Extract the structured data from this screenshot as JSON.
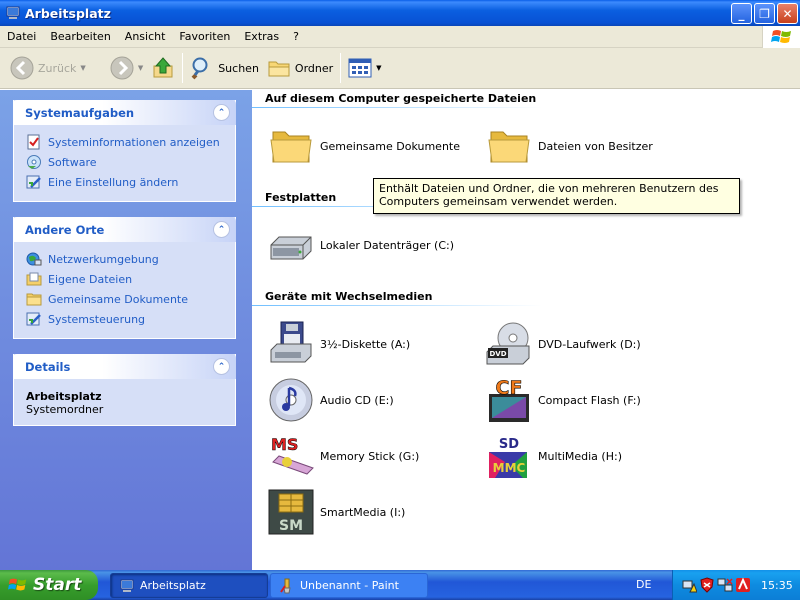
{
  "window": {
    "title": "Arbeitsplatz",
    "buttons": {
      "minimize": "_",
      "maximize": "❐",
      "close": "✕"
    }
  },
  "menu": {
    "items": [
      {
        "label": "Datei"
      },
      {
        "label": "Bearbeiten"
      },
      {
        "label": "Ansicht"
      },
      {
        "label": "Favoriten"
      },
      {
        "label": "Extras"
      },
      {
        "label": "?"
      }
    ]
  },
  "toolbar": {
    "back_label": "Zurück",
    "search_label": "Suchen",
    "folders_label": "Ordner"
  },
  "sidebar": {
    "system_tasks": {
      "title": "Systemaufgaben",
      "items": [
        {
          "label": "Systeminformationen anzeigen",
          "icon": "sysinfo-icon"
        },
        {
          "label": "Software",
          "icon": "software-icon"
        },
        {
          "label": "Eine Einstellung ändern",
          "icon": "settings-icon"
        }
      ]
    },
    "other_places": {
      "title": "Andere Orte",
      "items": [
        {
          "label": "Netzwerkumgebung",
          "icon": "network-icon"
        },
        {
          "label": "Eigene Dateien",
          "icon": "documents-icon"
        },
        {
          "label": "Gemeinsame Dokumente",
          "icon": "folder-icon"
        },
        {
          "label": "Systemsteuerung",
          "icon": "control-panel-icon"
        }
      ]
    },
    "details": {
      "title": "Details",
      "name": "Arbeitsplatz",
      "type": "Systemordner"
    }
  },
  "main": {
    "stored_files": {
      "title": "Auf diesem Computer gespeicherte Dateien",
      "items": [
        {
          "label": "Gemeinsame Dokumente",
          "icon": "folder-icon"
        },
        {
          "label": "Dateien von Besitzer",
          "icon": "folder-icon"
        }
      ]
    },
    "hard_disks": {
      "title": "Festplatten",
      "items": [
        {
          "label": "Lokaler Datenträger (C:)",
          "icon": "hard-disk-icon"
        }
      ]
    },
    "removable": {
      "title": "Geräte mit Wechselmedien",
      "items": [
        {
          "label": "3½-Diskette (A:)",
          "icon": "floppy-icon"
        },
        {
          "label": "DVD-Laufwerk (D:)",
          "icon": "dvd-icon"
        },
        {
          "label": "Audio CD (E:)",
          "icon": "audio-cd-icon"
        },
        {
          "label": "Compact Flash (F:)",
          "icon": "compact-flash-icon"
        },
        {
          "label": "Memory Stick (G:)",
          "icon": "memory-stick-icon"
        },
        {
          "label": "MultiMedia (H:)",
          "icon": "multimedia-card-icon"
        },
        {
          "label": "SmartMedia (I:)",
          "icon": "smartmedia-icon"
        }
      ]
    },
    "tooltip": "Enthält Dateien und Ordner, die von mehreren Benutzern des Computers gemeinsam verwendet werden."
  },
  "taskbar": {
    "start_label": "Start",
    "tasks": [
      {
        "label": "Arbeitsplatz",
        "active": true
      },
      {
        "label": "Unbenannt - Paint",
        "active": false
      }
    ],
    "language": "DE",
    "clock": "15:35"
  },
  "colors": {
    "accent": "#215dc6",
    "titlebar": "#0b5fe0",
    "sidebar_bg": "#7ba2e7",
    "tooltip_bg": "#ffffe1"
  }
}
